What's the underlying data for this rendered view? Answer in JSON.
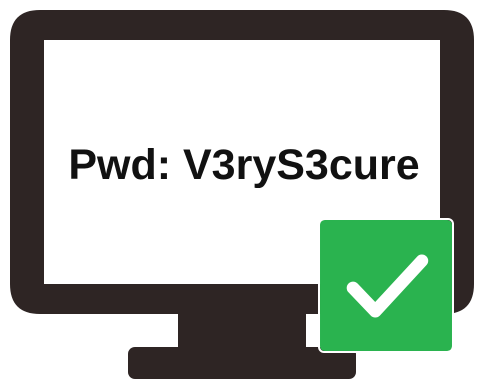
{
  "screen": {
    "password_text": "Pwd: V3ryS3cure"
  },
  "icons": {
    "monitor": "monitor-icon",
    "check": "checkmark-icon"
  },
  "colors": {
    "monitor_frame": "#2e2524",
    "screen_background": "#ffffff",
    "text": "#111111",
    "badge_green": "#2ab34f",
    "checkmark": "#ffffff"
  }
}
